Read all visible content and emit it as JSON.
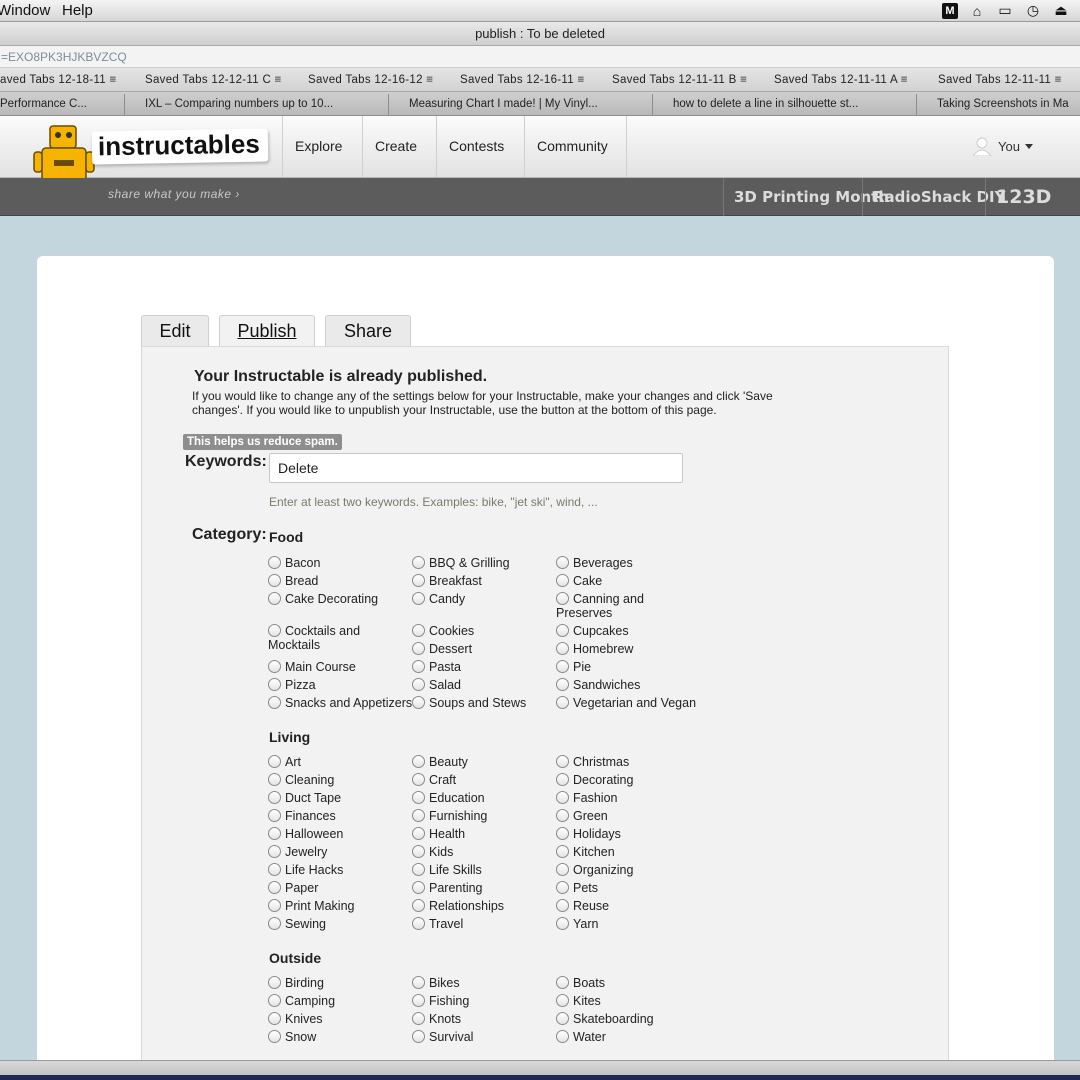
{
  "menubar": {
    "items": [
      "Window",
      "Help"
    ],
    "status_icons": [
      "m-icon",
      "home-icon",
      "airplay-icon",
      "time-machine-icon",
      "eject-icon"
    ]
  },
  "window": {
    "title": "publish : To be deleted"
  },
  "url": {
    "text": "=EXO8PK3HJKBVZCQ"
  },
  "bookmarks": [
    "aved Tabs 12-18-11 ≡",
    "Saved Tabs 12-12-11 C ≡",
    "Saved Tabs 12-16-12 ≡",
    "Saved Tabs 12-16-11 ≡",
    "Saved Tabs 12-11-11 B ≡",
    "Saved Tabs 12-11-11 A ≡",
    "Saved Tabs 12-11-11 ≡"
  ],
  "tabs": [
    "Performance C...",
    "IXL – Comparing numbers up to 10...",
    "Measuring Chart I made! | My Vinyl...",
    "how to delete a line in silhouette st...",
    "Taking Screenshots in Ma"
  ],
  "site": {
    "logo": "instructables",
    "tagline": "share what you make  ›",
    "nav": [
      "Explore",
      "Create",
      "Contests",
      "Community"
    ],
    "user": "You",
    "promos": [
      "3D Printing Month",
      "RadioShack DIY",
      "123D"
    ]
  },
  "editor_tabs": [
    "Edit",
    "Publish",
    "Share"
  ],
  "publish": {
    "title": "Your Instructable is already published.",
    "description": "If you would like to change any of the settings below for your Instructable, make your changes and click 'Save changes'. If you would like to unpublish your Instructable, use the button at the bottom of this page.",
    "spam_tip": "This helps us reduce spam.",
    "keywords_label": "Keywords:",
    "keywords_value": "Delete",
    "keywords_hint": "Enter at least two keywords. Examples: bike, \"jet ski\", wind, ...",
    "category_label": "Category:"
  },
  "categories": [
    {
      "name": "Food",
      "rows": [
        [
          "Bacon",
          "BBQ & Grilling",
          "Beverages"
        ],
        [
          "Bread",
          "Breakfast",
          "Cake"
        ],
        [
          "Cake Decorating",
          "Candy",
          "Canning and Preserves"
        ],
        [
          "Cocktails and Mocktails",
          "Cookies",
          "Cupcakes"
        ],
        [
          "",
          "Dessert",
          "Homebrew"
        ],
        [
          "Main Course",
          "Pasta",
          "Pie"
        ],
        [
          "Pizza",
          "Salad",
          "Sandwiches"
        ],
        [
          "Snacks and Appetizers",
          "Soups and Stews",
          "Vegetarian and Vegan"
        ]
      ]
    },
    {
      "name": "Living",
      "rows": [
        [
          "Art",
          "Beauty",
          "Christmas"
        ],
        [
          "Cleaning",
          "Craft",
          "Decorating"
        ],
        [
          "Duct Tape",
          "Education",
          "Fashion"
        ],
        [
          "Finances",
          "Furnishing",
          "Green"
        ],
        [
          "Halloween",
          "Health",
          "Holidays"
        ],
        [
          "Jewelry",
          "Kids",
          "Kitchen"
        ],
        [
          "Life Hacks",
          "Life Skills",
          "Organizing"
        ],
        [
          "Paper",
          "Parenting",
          "Pets"
        ],
        [
          "Print Making",
          "Relationships",
          "Reuse"
        ],
        [
          "Sewing",
          "Travel",
          "Yarn"
        ]
      ]
    },
    {
      "name": "Outside",
      "rows": [
        [
          "Birding",
          "Bikes",
          "Boats"
        ],
        [
          "Camping",
          "Fishing",
          "Kites"
        ],
        [
          "Knives",
          "Knots",
          "Skateboarding"
        ],
        [
          "Snow",
          "Survival",
          "Water"
        ]
      ]
    }
  ]
}
